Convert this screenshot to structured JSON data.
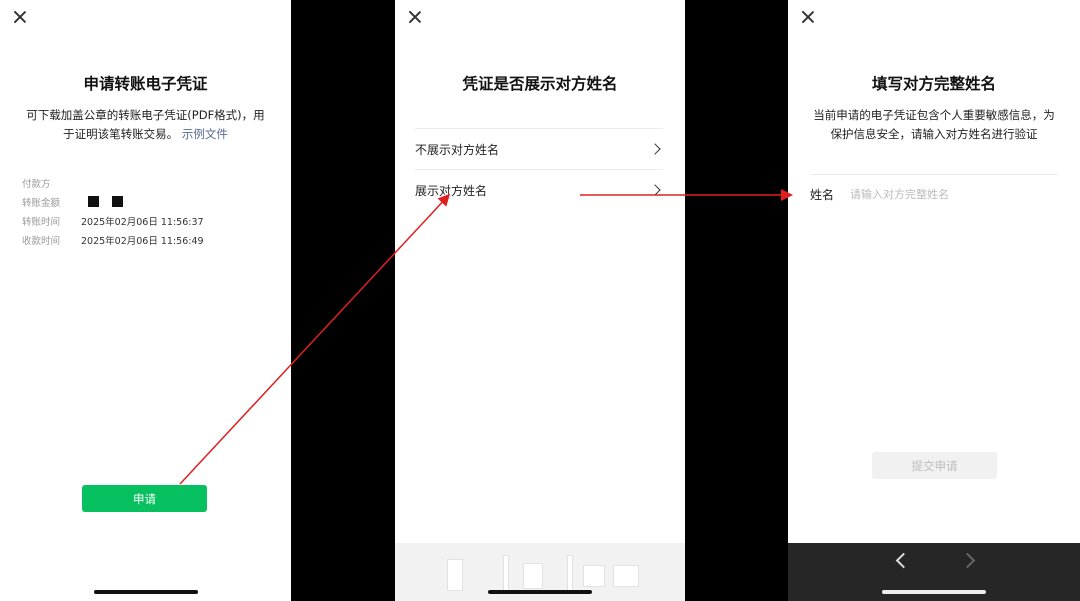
{
  "screen1": {
    "title": "申请转账电子凭证",
    "description": "可下载加盖公章的转账电子凭证(PDF格式)，用于证明该笔转账交易。",
    "example_link": "示例文件",
    "rows": [
      {
        "label": "付款方",
        "value": ""
      },
      {
        "label": "转账金额",
        "value": ""
      },
      {
        "label": "转账时间",
        "value": "2025年02月06日 11:56:37"
      },
      {
        "label": "收款时间",
        "value": "2025年02月06日 11:56:49"
      }
    ],
    "apply_button": "申请"
  },
  "screen2": {
    "title": "凭证是否展示对方姓名",
    "options": [
      {
        "label": "不展示对方姓名"
      },
      {
        "label": "展示对方姓名"
      }
    ]
  },
  "screen3": {
    "title": "填写对方完整姓名",
    "description": "当前申请的电子凭证包含个人重要敏感信息，为保护信息安全，请输入对方姓名进行验证",
    "field_label": "姓名",
    "field_placeholder": "请输入对方完整姓名",
    "submit_button": "提交申请"
  },
  "colors": {
    "accent_green": "#07c160",
    "link_blue": "#576b95",
    "annotation_red": "#e02020"
  },
  "icons": [
    "close-icon",
    "chevron-right-icon",
    "back-arrow-icon",
    "forward-arrow-icon"
  ]
}
